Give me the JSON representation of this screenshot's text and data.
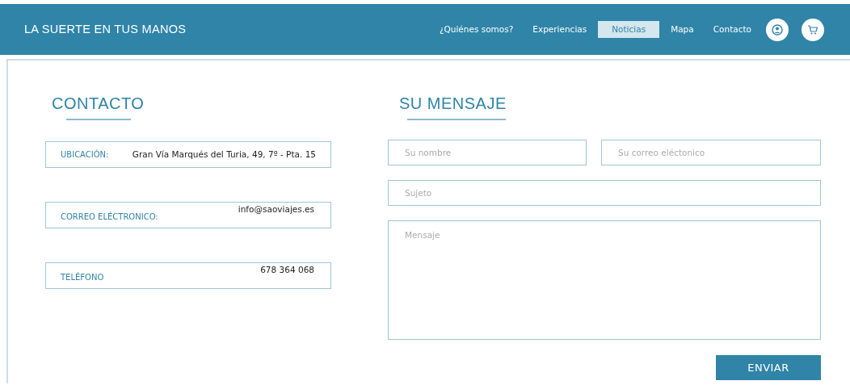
{
  "header": {
    "brand": "LA SUERTE EN TUS MANOS",
    "nav": [
      {
        "label": "¿Quiénes somos?",
        "selected": false
      },
      {
        "label": "Experiencias",
        "selected": false
      },
      {
        "label": "Noticias",
        "selected": true
      },
      {
        "label": "Mapa",
        "selected": false
      },
      {
        "label": "Contacto",
        "selected": false
      }
    ]
  },
  "contact": {
    "title": "CONTACTO",
    "items": [
      {
        "label": "UBICACIÓN:",
        "value": "Gran Vía Marqués del Turia, 49, 7º - Pta. 15"
      },
      {
        "label": "CORREO ELÉCTRONICO:",
        "value": "info@saoviajes.es"
      },
      {
        "label": "TELÉFONO",
        "value": "678 364 068"
      }
    ]
  },
  "message": {
    "title": "SU MENSAJE",
    "name": {
      "placeholder": "Su nombre"
    },
    "email": {
      "placeholder": "Su correo eléctonico"
    },
    "subject": {
      "placeholder": "Sujeto"
    },
    "body": {
      "placeholder": "Mensaje"
    },
    "submit": "ENVIAR"
  }
}
